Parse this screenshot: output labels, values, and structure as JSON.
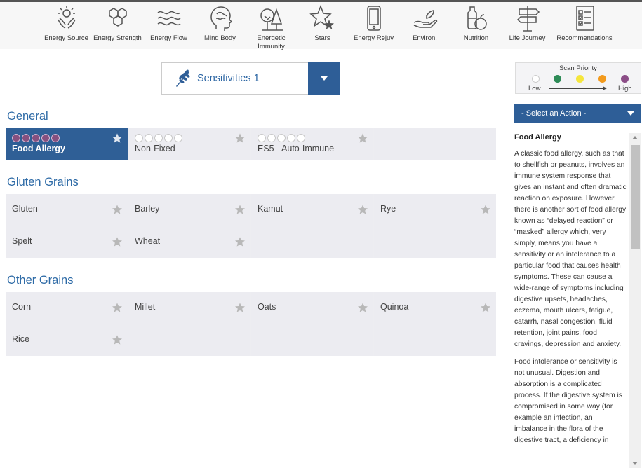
{
  "nav": {
    "items": [
      {
        "label": "Energy Source",
        "icon": "energy-source-icon"
      },
      {
        "label": "Energy Strength",
        "icon": "hexagon-icon"
      },
      {
        "label": "Energy Flow",
        "icon": "waves-icon"
      },
      {
        "label": "Mind Body",
        "icon": "head-brain-icon"
      },
      {
        "label": "Energetic Immunity",
        "icon": "tree-icon"
      },
      {
        "label": "Stars",
        "icon": "stars-icon"
      },
      {
        "label": "Energy Rejuv",
        "icon": "phone-icon"
      },
      {
        "label": "Environ.",
        "icon": "hand-plant-icon"
      },
      {
        "label": "Nutrition",
        "icon": "fruit-icon"
      },
      {
        "label": "Life Journey",
        "icon": "signpost-icon"
      },
      {
        "label": "Recommendations",
        "icon": "checklist-icon"
      }
    ]
  },
  "category_select": {
    "label": "Sensitivities 1",
    "icon": "wheat-icon"
  },
  "sections": {
    "general": {
      "title": "General",
      "items": [
        {
          "label": "Food Allergy",
          "selected": true
        },
        {
          "label": "Non-Fixed",
          "selected": false
        },
        {
          "label": "ES5 - Auto-Immune",
          "selected": false
        }
      ]
    },
    "gluten": {
      "title": "Gluten Grains",
      "items": [
        {
          "label": "Gluten"
        },
        {
          "label": "Barley"
        },
        {
          "label": "Kamut"
        },
        {
          "label": "Rye"
        },
        {
          "label": "Spelt"
        },
        {
          "label": "Wheat"
        }
      ]
    },
    "other": {
      "title": "Other Grains",
      "items": [
        {
          "label": "Corn"
        },
        {
          "label": "Millet"
        },
        {
          "label": "Oats"
        },
        {
          "label": "Quinoa"
        },
        {
          "label": "Rice"
        }
      ]
    }
  },
  "legend": {
    "title": "Scan Priority",
    "low": "Low",
    "high": "High",
    "colors": [
      "#ffffff",
      "#2e8b57",
      "#f5e63c",
      "#f29a1d",
      "#8b4d87"
    ]
  },
  "action_select": {
    "label": "- Select an Action -"
  },
  "description": {
    "title": "Food Allergy",
    "paragraphs": [
      "A classic food allergy, such as that to shellfish or peanuts, involves an immune system response that gives an instant and often dramatic reaction on exposure. However, there is another sort of food allergy known as “delayed reaction” or “masked” allergy which, very simply, means you have a sensitivity or an intolerance to a particular food that causes health symptoms. These can cause a wide-range of symptoms including digestive upsets, headaches, eczema, mouth ulcers, fatigue, catarrh, nasal congestion, fluid retention, joint pains, food cravings, depression and anxiety.",
      "Food intolerance or sensitivity is not unusual. Digestion and absorption is a complicated process. If the digestive system is compromised in some way (for example an infection, an imbalance in the flora of the digestive tract, a deficiency in"
    ]
  }
}
